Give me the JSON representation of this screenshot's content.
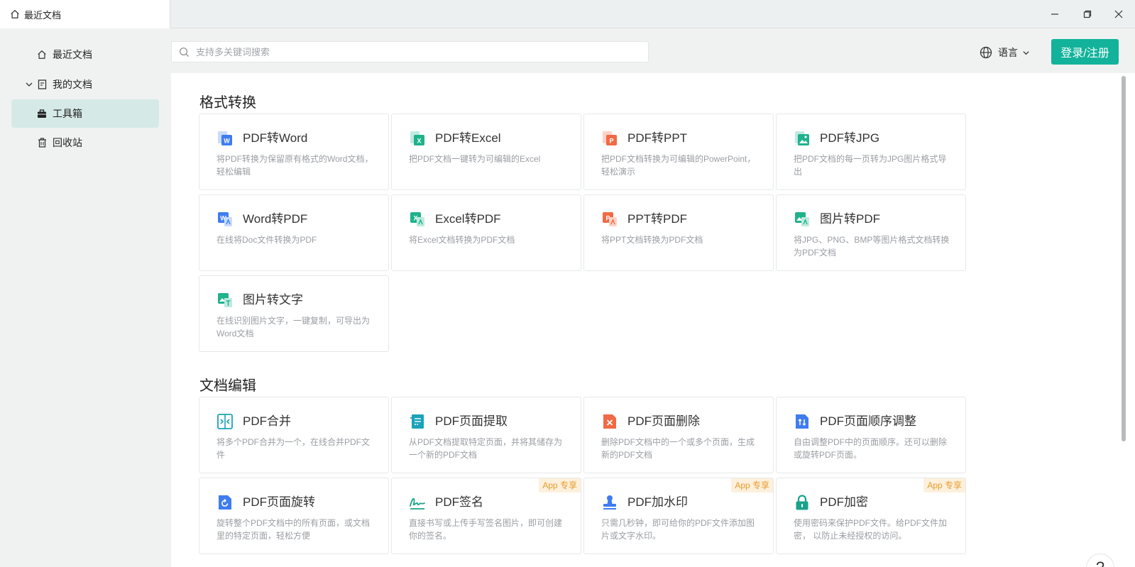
{
  "window": {
    "tab_label": "最近文档"
  },
  "sidebar": {
    "items": [
      {
        "label": "最近文档",
        "icon": "home-icon"
      },
      {
        "label": "我的文档",
        "icon": "document-icon"
      },
      {
        "label": "工具箱",
        "icon": "toolbox-icon",
        "active": true
      },
      {
        "label": "回收站",
        "icon": "trash-icon"
      }
    ]
  },
  "header": {
    "search_placeholder": "支持多关键词搜索",
    "language_label": "语言",
    "login_label": "登录/注册"
  },
  "colors": {
    "accent": "#12b39a",
    "active_nav": "#d5eae7",
    "badge_bg": "#fdf0dc",
    "badge_text": "#e79b2a"
  },
  "sections": [
    {
      "title": "格式转换",
      "cards": [
        {
          "title": "PDF转Word",
          "desc": "将PDF转换为保留原有格式的Word文档，轻松编辑",
          "icon": "pdf-to-word-icon"
        },
        {
          "title": "PDF转Excel",
          "desc": "把PDF文档一键转为可编辑的Excel",
          "icon": "pdf-to-excel-icon"
        },
        {
          "title": "PDF转PPT",
          "desc": "把PDF文档转换为可编辑的PowerPoint，轻松演示",
          "icon": "pdf-to-ppt-icon"
        },
        {
          "title": "PDF转JPG",
          "desc": "把PDF文档的每一页转为JPG图片格式导出",
          "icon": "pdf-to-jpg-icon"
        },
        {
          "title": "Word转PDF",
          "desc": "在线将Doc文件转换为PDF",
          "icon": "word-to-pdf-icon"
        },
        {
          "title": "Excel转PDF",
          "desc": "将Excel文档转换为PDF文档",
          "icon": "excel-to-pdf-icon"
        },
        {
          "title": "PPT转PDF",
          "desc": "将PPT文档转换为PDF文档",
          "icon": "ppt-to-pdf-icon"
        },
        {
          "title": "图片转PDF",
          "desc": "将JPG、PNG、BMP等图片格式文档转换为PDF文档",
          "icon": "image-to-pdf-icon"
        },
        {
          "title": "图片转文字",
          "desc": "在线识别图片文字，一键复制，可导出为Word文档",
          "icon": "image-to-text-icon"
        }
      ]
    },
    {
      "title": "文档编辑",
      "cards": [
        {
          "title": "PDF合并",
          "desc": "将多个PDF合并为一个，在线合并PDF文件",
          "icon": "pdf-merge-icon"
        },
        {
          "title": "PDF页面提取",
          "desc": "从PDF文档提取特定页面，并将其储存为一个新的PDF文档",
          "icon": "pdf-extract-icon"
        },
        {
          "title": "PDF页面删除",
          "desc": "删除PDF文档中的一个或多个页面，生成新的PDF文档",
          "icon": "pdf-delete-icon"
        },
        {
          "title": "PDF页面顺序调整",
          "desc": "自由调整PDF中的页面顺序。还可以删除或旋转PDF页面。",
          "icon": "pdf-reorder-icon"
        },
        {
          "title": "PDF页面旋转",
          "desc": "旋转整个PDF文档中的所有页面，或文档里的特定页面，轻松方便",
          "icon": "pdf-rotate-icon"
        },
        {
          "title": "PDF签名",
          "desc": "直接书写或上传手写签名图片，即可创建你的签名。",
          "icon": "pdf-sign-icon",
          "badge": "App 专享"
        },
        {
          "title": "PDF加水印",
          "desc": "只需几秒钟，即可给你的PDF文件添加图片或文字水印。",
          "icon": "pdf-watermark-icon",
          "badge": "App 专享"
        },
        {
          "title": "PDF加密",
          "desc": "使用密码来保护PDF文件。给PDF文件加密， 以防止未经授权的访问。",
          "icon": "pdf-encrypt-icon",
          "badge": "App 专享"
        }
      ]
    }
  ],
  "help_label": "?"
}
